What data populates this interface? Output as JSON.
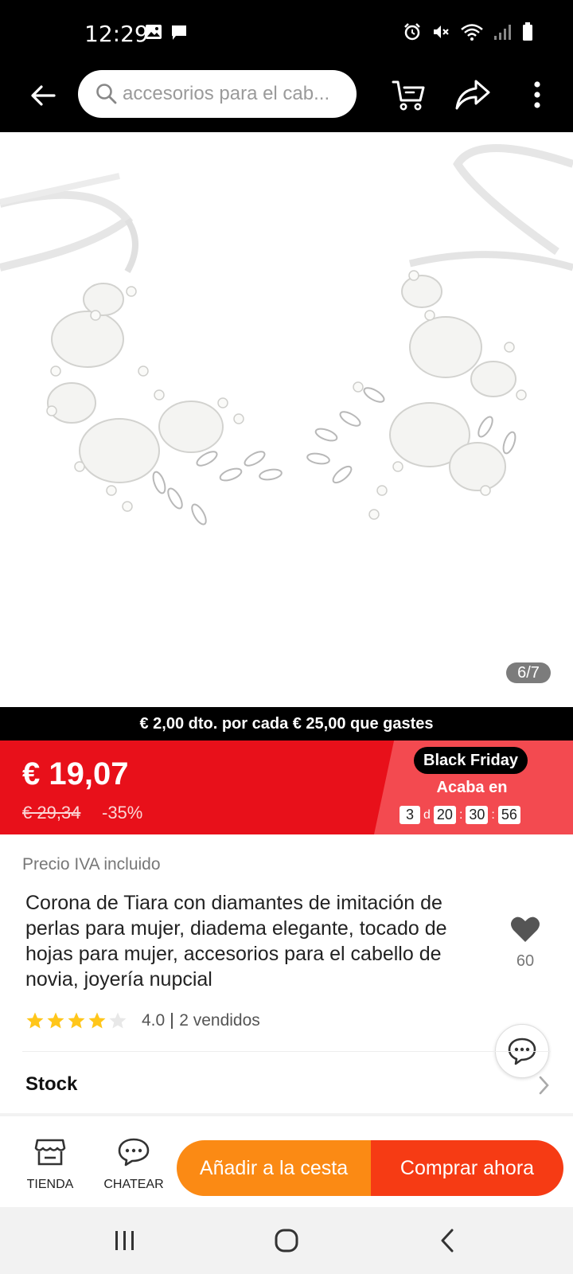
{
  "status_bar": {
    "time": "12:29",
    "left_icons": [
      "image-icon",
      "message-icon"
    ],
    "right_icons": [
      "alarm-icon",
      "mute-icon",
      "wifi-icon",
      "signal-icon",
      "battery-icon"
    ]
  },
  "top_nav": {
    "search_placeholder": "accesorios para el cab...",
    "icons": [
      "back-arrow-icon",
      "search-icon",
      "cart-icon",
      "share-icon",
      "more-icon"
    ]
  },
  "gallery": {
    "counter": "6/7"
  },
  "promo": {
    "text": "€ 2,00 dto. por cada € 25,00 que gastes"
  },
  "price": {
    "current": "€ 19,07",
    "original": "€ 29,34",
    "discount": "-35%"
  },
  "sale": {
    "badge": "Black Friday",
    "ends_label": "Acaba en",
    "days": "3",
    "days_unit": "d",
    "hours": "20",
    "minutes": "30",
    "seconds": "56"
  },
  "product": {
    "tax_note": "Precio IVA incluido",
    "title": "Corona de Tiara con diamantes de imitación de perlas para mujer, diadema elegante, tocado de hojas para mujer, accesorios para el cabello de novia, joyería nupcial",
    "wishlist_count": "60",
    "rating": "4.0",
    "rating_stars": 4,
    "sold": "2 vendidos"
  },
  "stock": {
    "label": "Stock"
  },
  "actions": {
    "store_label": "TIENDA",
    "chat_label": "CHATEAR",
    "add_to_cart": "Añadir a la cesta",
    "buy_now": "Comprar ahora"
  },
  "colors": {
    "sale_red": "#e8101a",
    "add_cart_orange": "#fb8a14",
    "buy_now_red": "#f63b14",
    "star_yellow": "#ffc61a"
  }
}
